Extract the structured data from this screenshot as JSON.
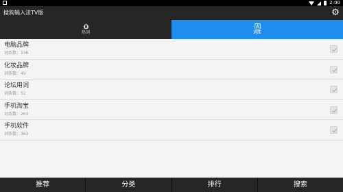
{
  "status_bar": {
    "time": "2:00"
  },
  "app": {
    "title": "搜狗输入法TV版",
    "settings_icon": "gear-icon"
  },
  "tabs": [
    {
      "label": "热词",
      "icon": "hot-words-icon",
      "active": false
    },
    {
      "label": "词库",
      "icon": "dictionary-icon",
      "active": true
    }
  ],
  "dictionaries": [
    {
      "name": "电脑品牌",
      "count": "词条数：136",
      "checked": true
    },
    {
      "name": "化妆品牌",
      "count": "词条数：49",
      "checked": true
    },
    {
      "name": "论坛用词",
      "count": "词条数：52",
      "checked": true
    },
    {
      "name": "手机淘宝",
      "count": "词条数：263",
      "checked": true
    },
    {
      "name": "手机软件",
      "count": "词条数：363",
      "checked": true
    }
  ],
  "bottom_nav": [
    {
      "label": "推荐"
    },
    {
      "label": "分类"
    },
    {
      "label": "排行"
    },
    {
      "label": "搜索"
    }
  ],
  "colors": {
    "accent": "#1e8ded",
    "bar": "#262626",
    "background": "#f4f4f4"
  }
}
